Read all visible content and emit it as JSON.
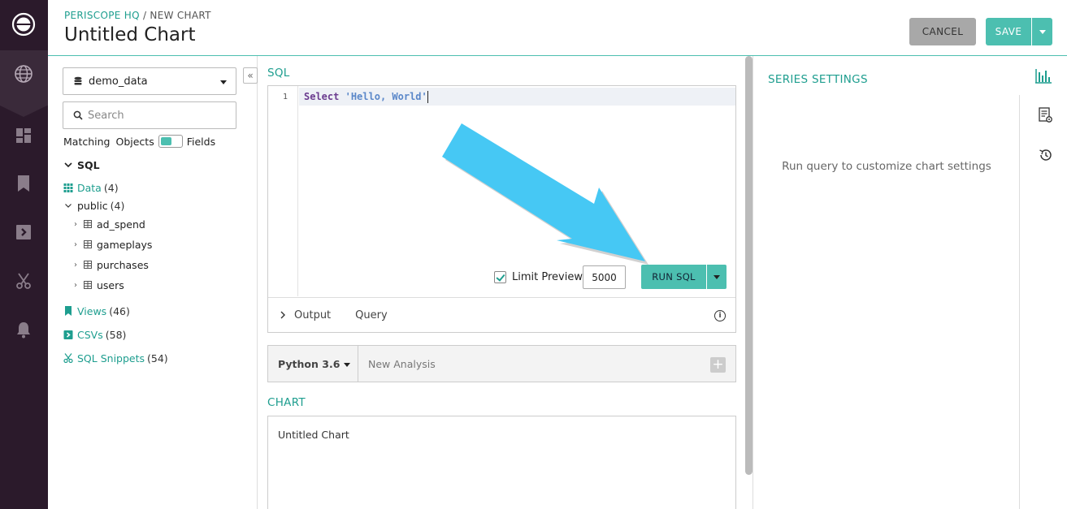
{
  "colors": {
    "accent": "#4cbfb0",
    "accent_text": "#1e9e8f",
    "rail": "#2b1a2b",
    "annotation_arrow": "#46c8f4"
  },
  "rail": {
    "items": [
      "logo-icon",
      "globe-icon",
      "dashboard-icon",
      "bookmark-icon",
      "csv-icon",
      "snippets-icon",
      "bell-icon"
    ]
  },
  "header": {
    "breadcrumb_link": "PERISCOPE HQ",
    "breadcrumb_separator": " / ",
    "breadcrumb_current": "NEW CHART",
    "title": "Untitled Chart",
    "cancel_label": "CANCEL",
    "save_label": "SAVE"
  },
  "schema": {
    "database": "demo_data",
    "search_placeholder": "Search",
    "matching_label": "Matching",
    "objects_label": "Objects",
    "fields_label": "Fields",
    "sql_label": "SQL",
    "data_label": "Data",
    "data_count": "(4)",
    "public_label": "public",
    "public_count": "(4)",
    "tables": [
      "ad_spend",
      "gameplays",
      "purchases",
      "users"
    ],
    "views_label": "Views",
    "views_count": "(46)",
    "csvs_label": "CSVs",
    "csvs_count": "(58)",
    "snippets_label": "SQL Snippets",
    "snippets_count": "(54)"
  },
  "editor": {
    "section_label": "SQL",
    "line_number": "1",
    "code_keyword": "Select",
    "code_string": "'Hello, World'",
    "limit_preview_label": "Limit Preview",
    "limit_value": "5000",
    "run_label": "RUN SQL",
    "output_tab": "Output",
    "query_tab": "Query"
  },
  "python": {
    "version": "Python 3.6",
    "new_analysis": "New Analysis"
  },
  "chart": {
    "section_label": "CHART",
    "name": "Untitled Chart"
  },
  "series": {
    "title": "SERIES SETTINGS",
    "message": "Run query to customize chart settings"
  }
}
